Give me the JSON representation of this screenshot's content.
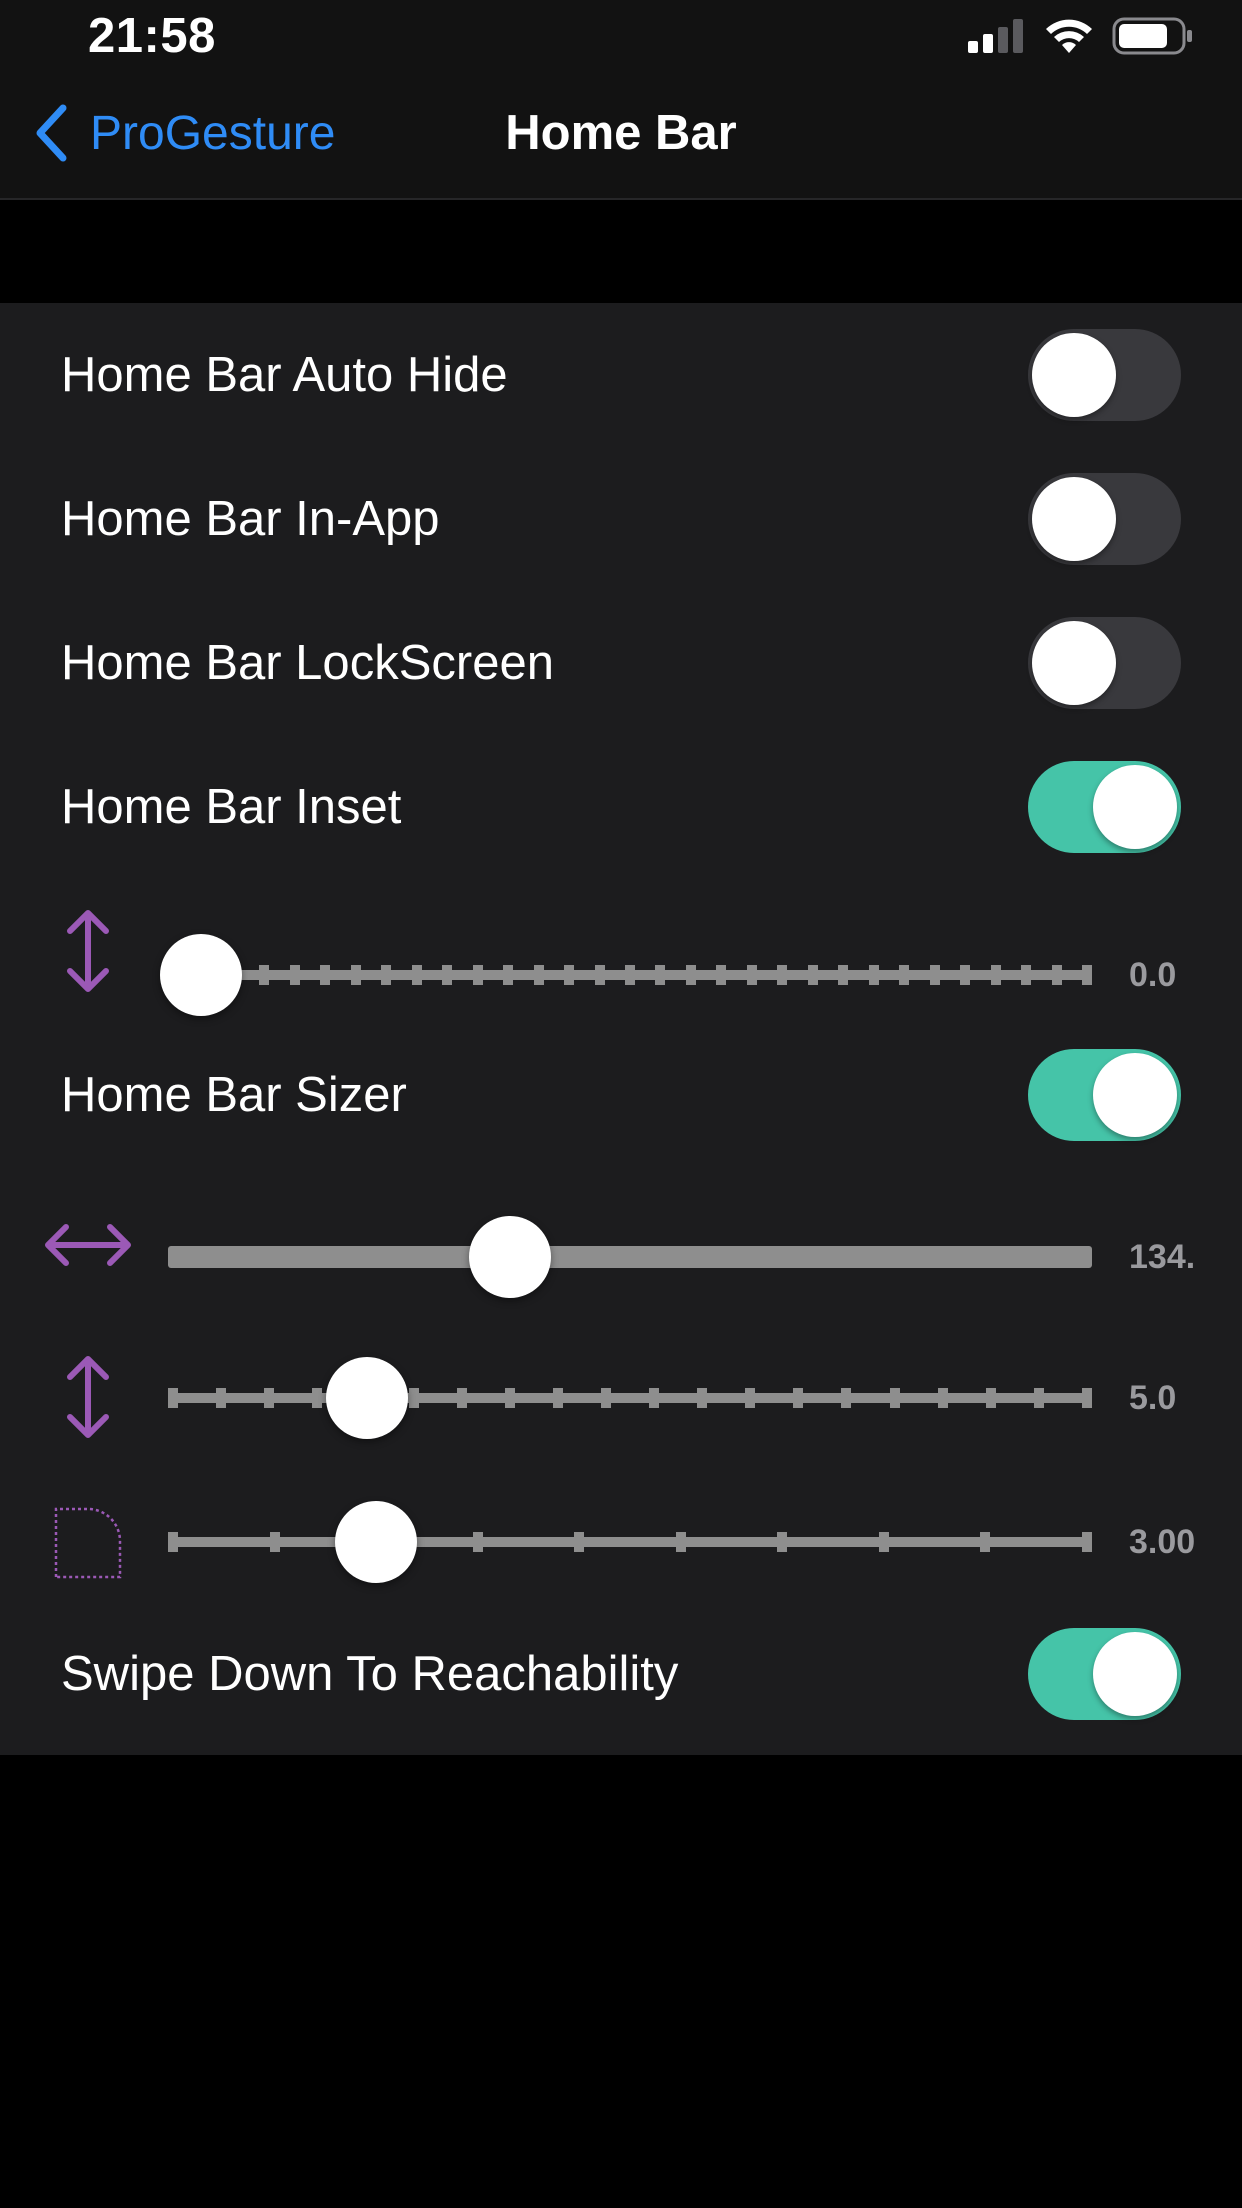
{
  "status_bar": {
    "time": "21:58",
    "icons": [
      "cellular-signal-icon",
      "wifi-icon",
      "battery-icon"
    ]
  },
  "nav": {
    "back_label": "ProGesture",
    "title": "Home Bar"
  },
  "colors": {
    "accent_blue": "#2f8cf6",
    "toggle_on": "#45c4a8",
    "toggle_off": "#39393d",
    "icon_purple": "#9b59b6",
    "track": "#8e8e8e"
  },
  "settings": {
    "auto_hide": {
      "label": "Home Bar Auto Hide",
      "on": false
    },
    "in_app": {
      "label": "Home Bar In-App",
      "on": false
    },
    "lock_screen": {
      "label": "Home Bar LockScreen",
      "on": false
    },
    "inset": {
      "label": "Home Bar Inset",
      "on": true
    },
    "inset_slider": {
      "icon": "vertical-arrows-icon",
      "value_text": "0.0",
      "fraction": 0.0
    },
    "sizer": {
      "label": "Home Bar Sizer",
      "on": true
    },
    "width_slider": {
      "icon": "horizontal-arrows-icon",
      "value_text": "134.",
      "fraction": 0.37
    },
    "height_slider": {
      "icon": "vertical-arrows-icon",
      "value_text": "5.0",
      "fraction": 0.215
    },
    "corner_slider": {
      "icon": "corner-radius-icon",
      "value_text": "3.00",
      "fraction": 0.225
    },
    "reachability": {
      "label": "Swipe Down To Reachability",
      "on": true
    }
  }
}
